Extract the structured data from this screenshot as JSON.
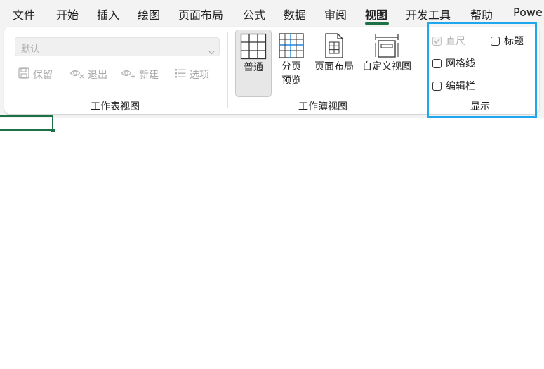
{
  "menubar": {
    "tabs": [
      {
        "label": "文件",
        "active": false
      },
      {
        "label": "开始",
        "active": false
      },
      {
        "label": "插入",
        "active": false
      },
      {
        "label": "绘图",
        "active": false
      },
      {
        "label": "页面布局",
        "active": false
      },
      {
        "label": "公式",
        "active": false
      },
      {
        "label": "数据",
        "active": false
      },
      {
        "label": "审阅",
        "active": false
      },
      {
        "label": "视图",
        "active": true
      },
      {
        "label": "开发工具",
        "active": false
      },
      {
        "label": "帮助",
        "active": false
      },
      {
        "label": "Powe",
        "active": false
      }
    ],
    "active_color": "#1e7145"
  },
  "sheet_view": {
    "dropdown_value": "默认",
    "buttons": [
      {
        "label": "保留",
        "icon": "save-icon"
      },
      {
        "label": "退出",
        "icon": "eye-exit-icon"
      },
      {
        "label": "新建",
        "icon": "eye-new-icon"
      },
      {
        "label": "选项",
        "icon": "list-options-icon"
      }
    ],
    "group_label": "工作表视图"
  },
  "workbook_view": {
    "buttons": [
      {
        "label_lines": [
          "普通"
        ],
        "icon": "grid-normal-icon",
        "active": true
      },
      {
        "label_lines": [
          "分页",
          "预览"
        ],
        "icon": "page-break-preview-icon",
        "active": false
      },
      {
        "label_lines": [
          "页面布局"
        ],
        "icon": "page-layout-icon",
        "active": false
      },
      {
        "label_lines": [
          "自定义视图"
        ],
        "icon": "custom-view-icon",
        "active": false
      }
    ],
    "group_label": "工作簿视图"
  },
  "show": {
    "checkboxes": [
      {
        "label": "直尺",
        "checked": true,
        "disabled": true
      },
      {
        "label": "标题",
        "checked": false,
        "disabled": false
      },
      {
        "label": "网格线",
        "checked": false,
        "disabled": false
      },
      {
        "label": "编辑栏",
        "checked": false,
        "disabled": false
      }
    ],
    "group_label": "显示",
    "highlight_color": "#1ea7ec"
  }
}
